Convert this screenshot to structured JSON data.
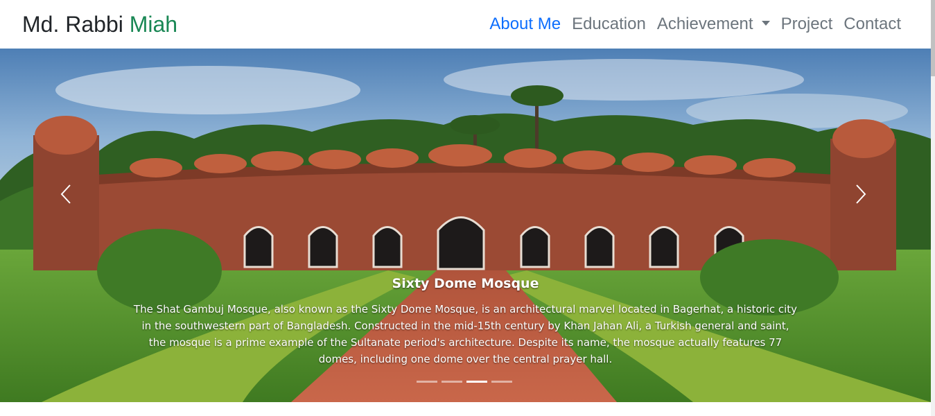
{
  "brand": {
    "first": "Md. Rabbi",
    "second": "Miah"
  },
  "nav": {
    "items": [
      {
        "label": "About Me"
      },
      {
        "label": "Education"
      },
      {
        "label": "Achievement"
      },
      {
        "label": "Project"
      },
      {
        "label": "Contact"
      }
    ],
    "active_index": 0,
    "dropdown_item": "Achievement"
  },
  "carousel": {
    "slide_count": 4,
    "active_slide": 3,
    "caption": {
      "title": "Sixty Dome Mosque",
      "text": "The Shat Gambuj Mosque, also known as the Sixty Dome Mosque, is an architectural marvel located in Bagerhat, a historic city in the southwestern part of Bangladesh. Constructed in the mid-15th century by Khan Jahan Ali, a Turkish general and saint, the mosque is a prime example of the Sultanate period's architecture. Despite its name, the mosque actually features 77 domes, including one dome over the central prayer hall."
    },
    "prev_icon": "chevron-left-icon",
    "next_icon": "chevron-right-icon"
  },
  "colors": {
    "accent": "#198754",
    "link_active": "#0d6efd",
    "link": "#6c757d"
  }
}
